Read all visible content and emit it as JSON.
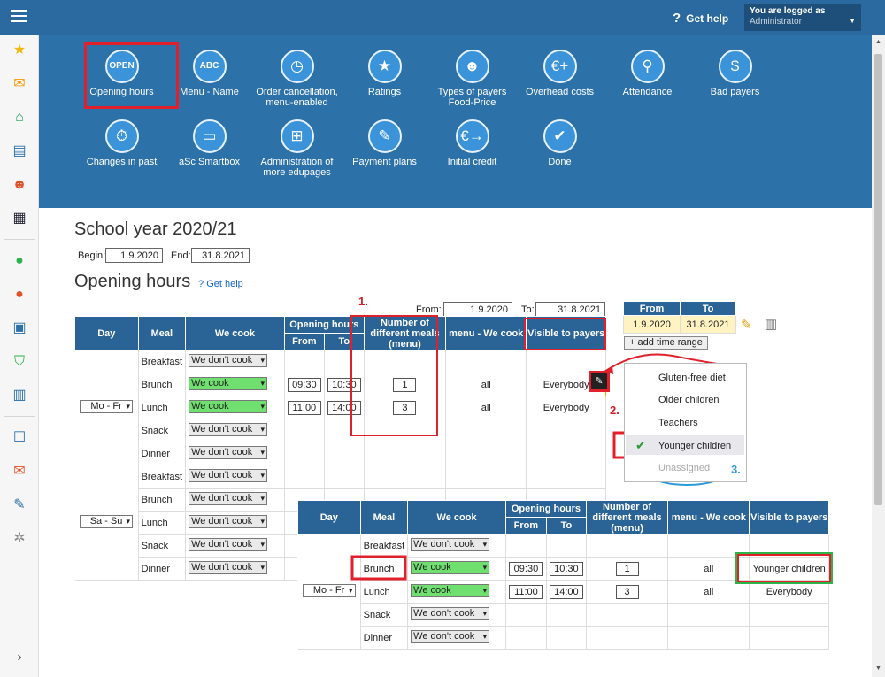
{
  "topbar": {
    "help": "Get help",
    "logged_label": "You are logged as",
    "user": "Administrator"
  },
  "sidebar_icons": [
    "star-icon",
    "mail-icon",
    "home-icon",
    "book-icon",
    "user-icon",
    "calendar-icon",
    "check-icon",
    "alert-icon",
    "briefcase-icon",
    "shield-icon",
    "chart-icon",
    "open-book-icon",
    "chat-icon",
    "pen-icon",
    "gear-icon",
    "expand-icon"
  ],
  "tiles": [
    {
      "label": "Opening hours",
      "icon": "open-sign-icon",
      "glyph": "OPEN"
    },
    {
      "label": "Menu - Name",
      "icon": "abc-icon",
      "glyph": "ABC"
    },
    {
      "label": "Order cancellation, menu-enabled",
      "icon": "clock-icon",
      "glyph": "◷"
    },
    {
      "label": "Ratings",
      "icon": "star-icon",
      "glyph": "★"
    },
    {
      "label": "Types of payers Food-Price",
      "icon": "payer-icon",
      "glyph": "☻"
    },
    {
      "label": "Overhead costs",
      "icon": "euro-plus-icon",
      "glyph": "€+"
    },
    {
      "label": "Attendance",
      "icon": "walking-icon",
      "glyph": "⚲"
    },
    {
      "label": "Bad payers",
      "icon": "money-bag-icon",
      "glyph": "$"
    },
    {
      "label": "Changes in past",
      "icon": "stopwatch-icon",
      "glyph": "⏱"
    },
    {
      "label": "aSc Smartbox",
      "icon": "monitor-icon",
      "glyph": "▭"
    },
    {
      "label": "Administration of more edupages",
      "icon": "hierarchy-icon",
      "glyph": "⊞"
    },
    {
      "label": "Payment plans",
      "icon": "payment-icon",
      "glyph": "✎"
    },
    {
      "label": "Initial credit",
      "icon": "euro-arrow-icon",
      "glyph": "€→"
    },
    {
      "label": "Done",
      "icon": "check-icon",
      "glyph": "✔"
    }
  ],
  "school_year": {
    "title": "School year 2020/21",
    "begin_label": "Begin:",
    "begin": "1.9.2020",
    "end_label": "End:",
    "end": "31.8.2021"
  },
  "opening": {
    "title": "Opening hours",
    "help": "Get help",
    "from_label": "From:",
    "from": "1.9.2020",
    "to_label": "To:",
    "to": "31.8.2021"
  },
  "range_table": {
    "headers": [
      "From",
      "To"
    ],
    "row": [
      "1.9.2020",
      "31.8.2021"
    ],
    "add": "+ add time range"
  },
  "headers": {
    "day": "Day",
    "meal": "Meal",
    "cook": "We cook",
    "oh": "Opening hours",
    "from": "From",
    "to": "To",
    "num": "Number of different meals (menu)",
    "menu": "menu - We cook",
    "vis": "Visible to payers"
  },
  "meals": [
    "Breakfast",
    "Brunch",
    "Lunch",
    "Snack",
    "Dinner"
  ],
  "day1": "Mo - Fr",
  "day2": "Sa - Su",
  "cook": {
    "no": "We don't cook",
    "yes": "We cook"
  },
  "rows": {
    "brunch": {
      "from": "09:30",
      "to": "10:30",
      "num": "1",
      "menu": "all",
      "vis": "Everybody"
    },
    "lunch": {
      "from": "11:00",
      "to": "14:00",
      "num": "3",
      "menu": "all",
      "vis": "Everybody"
    }
  },
  "dropdown": [
    "Gluten-free diet",
    "Older children",
    "Teachers",
    "Younger children",
    "Unassigned"
  ],
  "annotations": [
    "1.",
    "2.",
    "3."
  ],
  "result": {
    "brunch_vis": "Younger children",
    "lunch_vis": "Everybody"
  }
}
